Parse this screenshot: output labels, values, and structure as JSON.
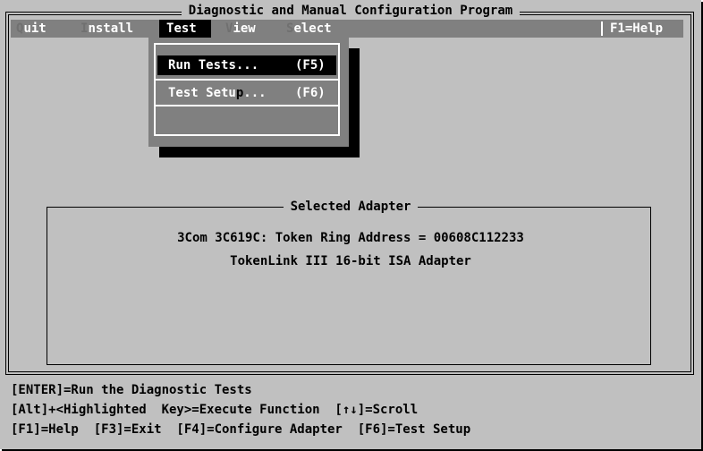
{
  "window": {
    "title": "Diagnostic and Manual Configuration Program"
  },
  "menu": {
    "items": [
      {
        "hot": "Q",
        "rest": "uit"
      },
      {
        "hot": "I",
        "rest": "nstall"
      },
      {
        "hot": "T",
        "rest": "est"
      },
      {
        "hot": "V",
        "rest": "iew"
      },
      {
        "hot": "S",
        "rest": "elect"
      }
    ],
    "active": "Test",
    "help": "F1=Help"
  },
  "dropdown": {
    "items": [
      {
        "pre": "",
        "hot": "R",
        "post": "un Tests...",
        "key": "(F5)"
      },
      {
        "pre": "Test Setu",
        "hot": "p",
        "post": "...",
        "key": "(F6)"
      }
    ]
  },
  "adapter": {
    "title": "Selected Adapter",
    "line1": "3Com 3C619C: Token Ring Address = 00608C112233",
    "line2": "TokenLink III 16-bit ISA Adapter"
  },
  "status": {
    "line1": "[ENTER]=Run the Diagnostic Tests",
    "line2": "[Alt]+<Highlighted  Key>=Execute Function  [↑↓]=Scroll",
    "line3": "[F1]=Help  [F3]=Exit  [F4]=Configure Adapter  [F6]=Test Setup"
  },
  "colors": {
    "background": "#c0c0c0",
    "menubar": "#808080",
    "highlight": "#000000",
    "menu_text": "#ffffff",
    "hotkey_dim": "#707070"
  }
}
